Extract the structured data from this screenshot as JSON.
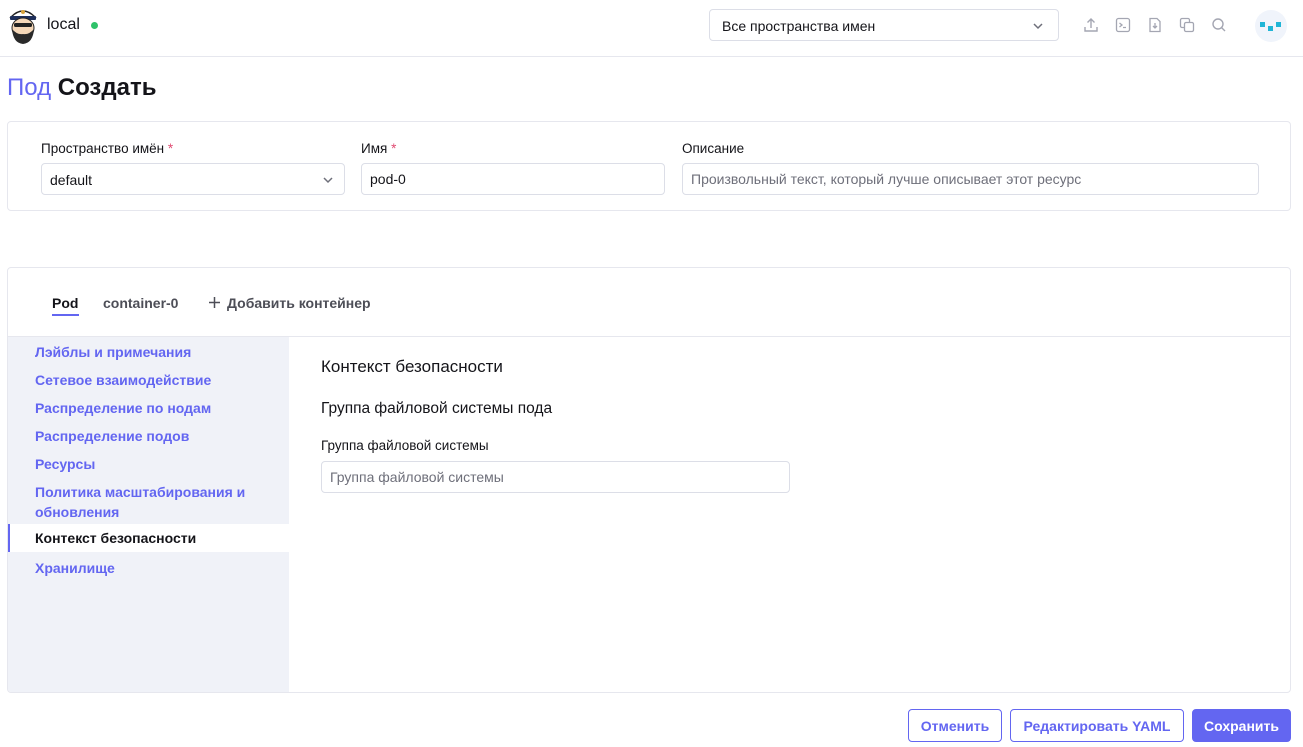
{
  "header": {
    "cluster_name": "local",
    "namespace_selector": "Все пространства имен",
    "icons": [
      "import-yaml-icon",
      "kubectl-shell-icon",
      "kubeconfig-download-icon",
      "copy-kubeconfig-icon",
      "search-icon"
    ]
  },
  "title": {
    "resource": "Под",
    "action": "Создать"
  },
  "metadata": {
    "namespace": {
      "label": "Пространство имён",
      "required": "*",
      "value": "default"
    },
    "name": {
      "label": "Имя",
      "required": "*",
      "value": "pod-0"
    },
    "description": {
      "label": "Описание",
      "placeholder": "Произвольный текст, который лучше описывает этот ресурс"
    }
  },
  "tabs": [
    {
      "label": "Pod"
    },
    {
      "label": "container-0"
    }
  ],
  "add_container": "Добавить контейнер",
  "side_nav": [
    {
      "label": "Лэйблы и примечания"
    },
    {
      "label": "Сетевое взаимодействие"
    },
    {
      "label": "Распределение по нодам"
    },
    {
      "label": "Распределение подов"
    },
    {
      "label": "Ресурсы"
    },
    {
      "label": "Политика масштабирования и обновления"
    },
    {
      "label": "Контекст безопасности"
    },
    {
      "label": "Хранилище"
    }
  ],
  "active_nav_index": 6,
  "section": {
    "title": "Контекст безопасности",
    "subtitle": "Группа файловой системы пода",
    "field_label": "Группа файловой системы",
    "field_placeholder": "Группа файловой системы"
  },
  "footer": {
    "cancel": "Отменить",
    "edit_yaml": "Редактировать YAML",
    "save": "Сохранить"
  },
  "colors": {
    "accent": "#6366f1",
    "status_ok": "#2fc26a",
    "required": "#e04b72",
    "nav_bg": "#f0f2f8"
  }
}
